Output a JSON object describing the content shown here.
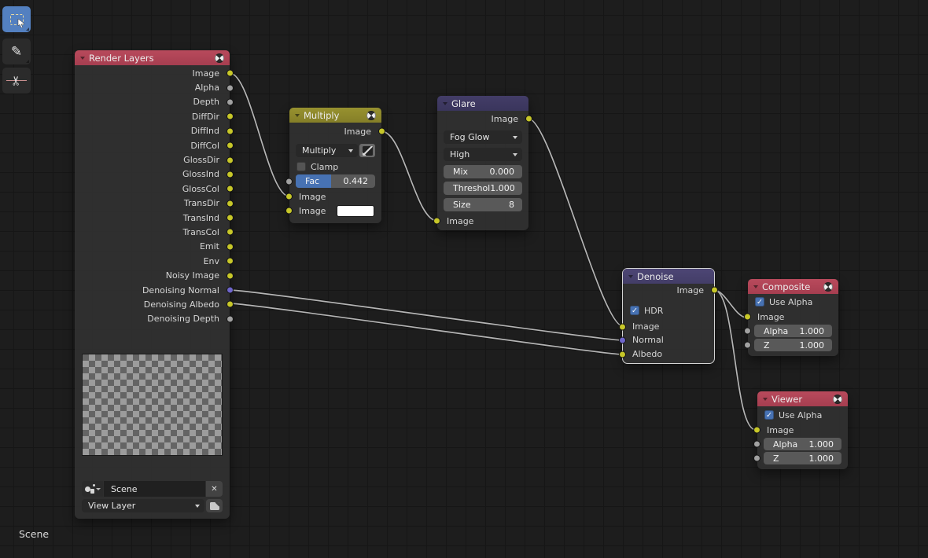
{
  "view": {
    "scene_overlay": "Scene"
  },
  "icons": {
    "annotate": "✎",
    "cut": "✂",
    "close": "✕"
  },
  "colors": {
    "accent_blue": "#4772b3",
    "socket_color": "#c7c729",
    "socket_value": "#a1a1a1",
    "socket_vector": "#6f66cc",
    "header_red": "#b04455",
    "header_olive": "#8f8b2d",
    "header_glare": "#3e3963",
    "header_denoise": "#4a4370",
    "wire": "#b5b5b5",
    "background": "#1d1d1d"
  },
  "nodes": {
    "render_layers": {
      "title": "Render Layers",
      "outputs": [
        {
          "label": "Image",
          "type": "color"
        },
        {
          "label": "Alpha",
          "type": "value"
        },
        {
          "label": "Depth",
          "type": "value"
        },
        {
          "label": "DiffDir",
          "type": "color"
        },
        {
          "label": "DiffInd",
          "type": "color"
        },
        {
          "label": "DiffCol",
          "type": "color"
        },
        {
          "label": "GlossDir",
          "type": "color"
        },
        {
          "label": "GlossInd",
          "type": "color"
        },
        {
          "label": "GlossCol",
          "type": "color"
        },
        {
          "label": "TransDir",
          "type": "color"
        },
        {
          "label": "TransInd",
          "type": "color"
        },
        {
          "label": "TransCol",
          "type": "color"
        },
        {
          "label": "Emit",
          "type": "color"
        },
        {
          "label": "Env",
          "type": "color"
        },
        {
          "label": "Noisy Image",
          "type": "color"
        },
        {
          "label": "Denoising Normal",
          "type": "vector"
        },
        {
          "label": "Denoising Albedo",
          "type": "color"
        },
        {
          "label": "Denoising Depth",
          "type": "value"
        }
      ],
      "scene_field": {
        "value": "Scene"
      },
      "view_layer_field": {
        "value": "View Layer"
      }
    },
    "multiply": {
      "title": "Multiply",
      "output_label": "Image",
      "blend_mode": "Multiply",
      "clamp_label": "Clamp",
      "fac": {
        "label": "Fac",
        "value": "0.442",
        "fill_percent": 44.2
      },
      "input1_label": "Image",
      "input2_label": "Image"
    },
    "glare": {
      "title": "Glare",
      "output_label": "Image",
      "glare_type": "Fog Glow",
      "quality": "High",
      "mix": {
        "label": "Mix",
        "value": "0.000"
      },
      "threshold": {
        "label": "Threshol",
        "value": "1.000"
      },
      "size": {
        "label": "Size",
        "value": "8"
      },
      "input_label": "Image"
    },
    "denoise": {
      "title": "Denoise",
      "output_label": "Image",
      "hdr_label": "HDR",
      "inputs": [
        {
          "label": "Image",
          "type": "color"
        },
        {
          "label": "Normal",
          "type": "vector"
        },
        {
          "label": "Albedo",
          "type": "color"
        }
      ]
    },
    "composite": {
      "title": "Composite",
      "use_alpha_label": "Use Alpha",
      "image_label": "Image",
      "alpha": {
        "label": "Alpha",
        "value": "1.000"
      },
      "z": {
        "label": "Z",
        "value": "1.000"
      }
    },
    "viewer": {
      "title": "Viewer",
      "use_alpha_label": "Use Alpha",
      "image_label": "Image",
      "alpha": {
        "label": "Alpha",
        "value": "1.000"
      },
      "z": {
        "label": "Z",
        "value": "1.000"
      }
    }
  }
}
